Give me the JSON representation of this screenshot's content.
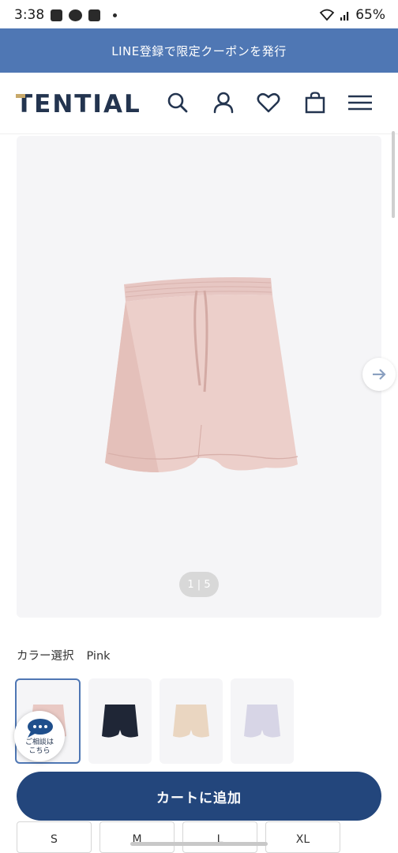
{
  "status_bar": {
    "time": "3:38",
    "battery": "65%",
    "icons": [
      "image-icon",
      "app-icon",
      "app-icon",
      "dot-icon",
      "wifi-icon",
      "signal-icon"
    ]
  },
  "banner": {
    "text": "LINE登録で限定クーポンを発行"
  },
  "header": {
    "logo": "TENTIAL",
    "icons": [
      "search-icon",
      "account-icon",
      "heart-icon",
      "bag-icon",
      "menu-icon"
    ]
  },
  "gallery": {
    "page_indicator": "1 | 5",
    "next_icon": "arrow-right-icon",
    "zoom_icon": "plus-icon"
  },
  "color_select": {
    "label": "カラー選択",
    "value": "Pink",
    "options": [
      {
        "name": "Pink",
        "color": "#e9c9c4"
      },
      {
        "name": "Navy",
        "color": "#1f2636"
      },
      {
        "name": "Beige",
        "color": "#ead6c1"
      },
      {
        "name": "Lavender",
        "color": "#d7d5e6"
      }
    ]
  },
  "chat": {
    "line1": "ご相談は",
    "line2": "こちら"
  },
  "cart": {
    "label": "カートに追加"
  },
  "sizes": [
    "S",
    "M",
    "L",
    "XL"
  ],
  "colors": {
    "banner": "#4f77b4",
    "primary": "#23467c",
    "logo": "#23344f"
  }
}
